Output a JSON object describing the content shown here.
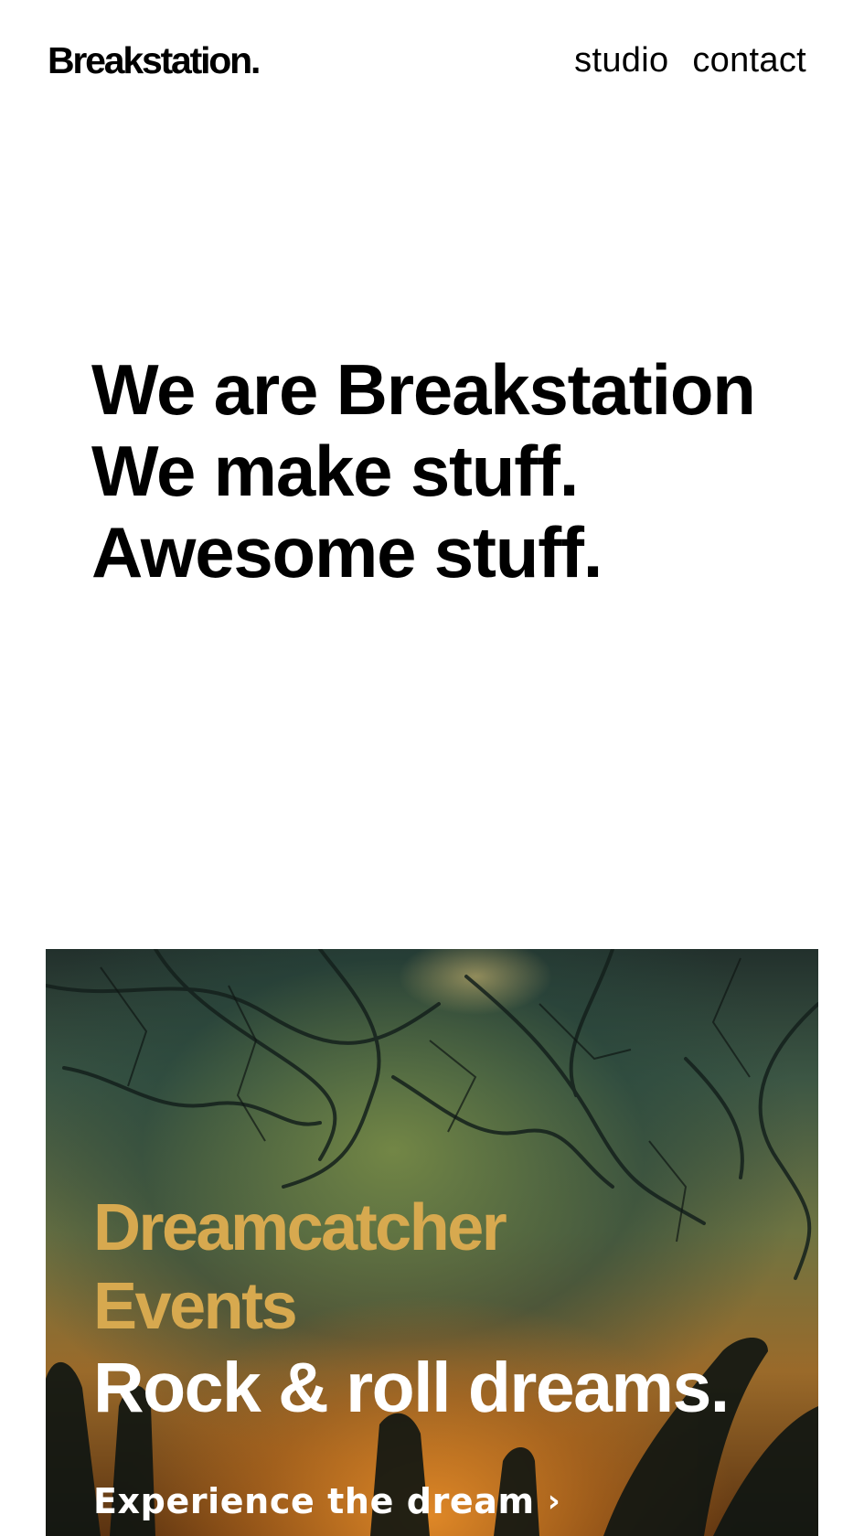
{
  "header": {
    "logo": "Breakstation.",
    "nav": [
      {
        "label": "studio"
      },
      {
        "label": "contact"
      }
    ]
  },
  "hero": {
    "lines": [
      "We are Breakstation",
      "We make stuff.",
      "Awesome stuff."
    ]
  },
  "feature": {
    "client_line1": "Dreamcatcher",
    "client_line2": "Events",
    "tagline": "Rock & roll dreams.",
    "cta_label": "Experience the dream",
    "cta_icon": "chevron-right-icon"
  },
  "colors": {
    "background": "#ffffff",
    "text": "#000000",
    "accent_gold": "#d7a94f",
    "card_text": "#ffffff"
  }
}
